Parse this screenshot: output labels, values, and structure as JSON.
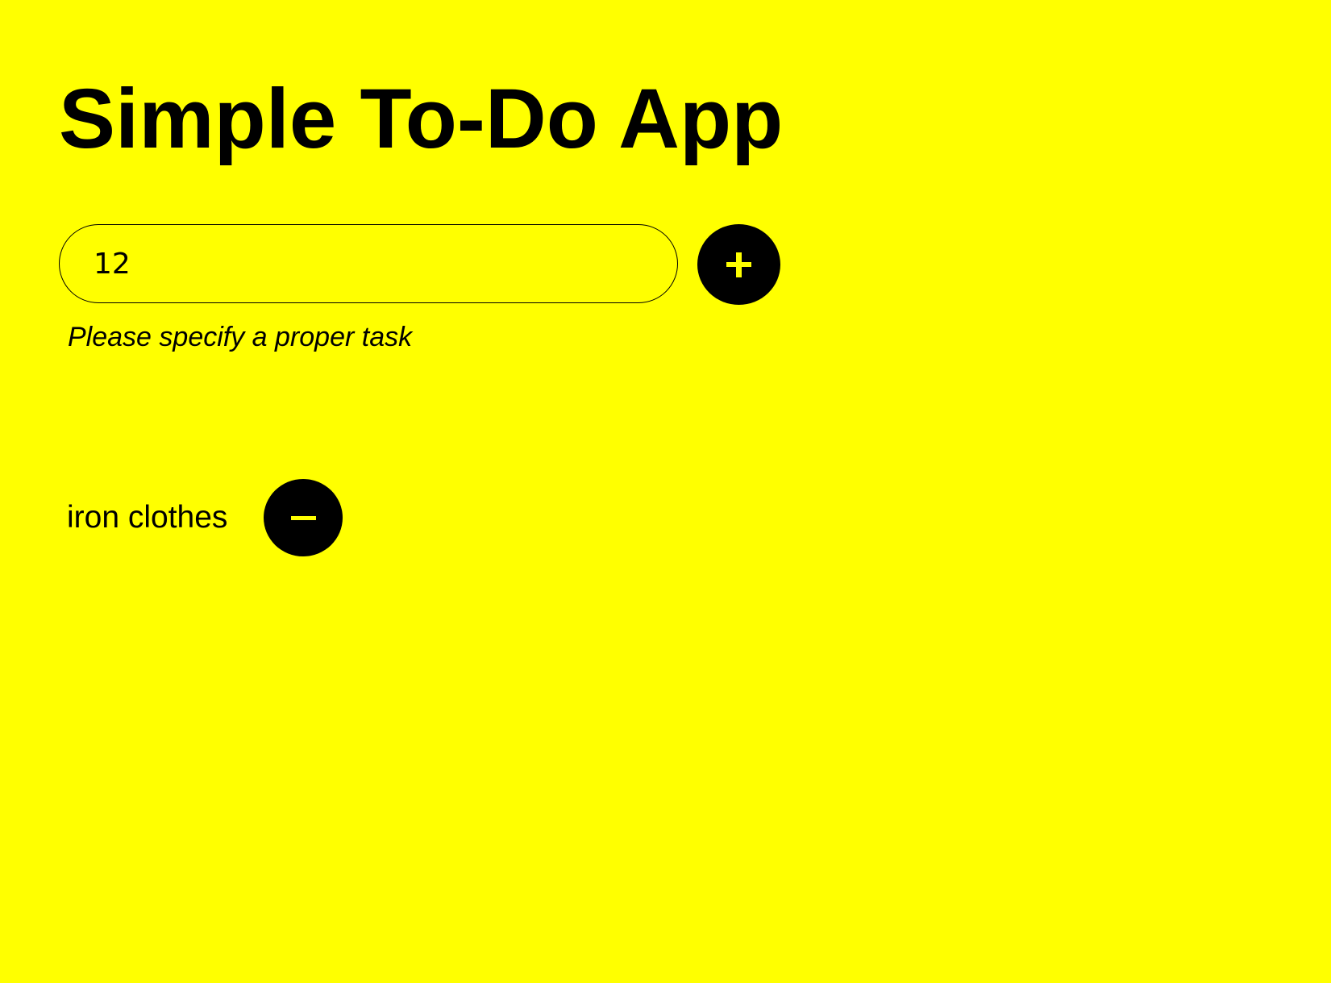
{
  "app": {
    "title": "Simple To-Do App",
    "background_color": "#FFFF00",
    "accent_color": "#000000"
  },
  "task_form": {
    "input_value": "12",
    "add_button_icon": "plus-icon",
    "error_message": "Please specify a proper task"
  },
  "tasks": [
    {
      "label": "iron clothes",
      "remove_button_icon": "minus-icon"
    }
  ]
}
